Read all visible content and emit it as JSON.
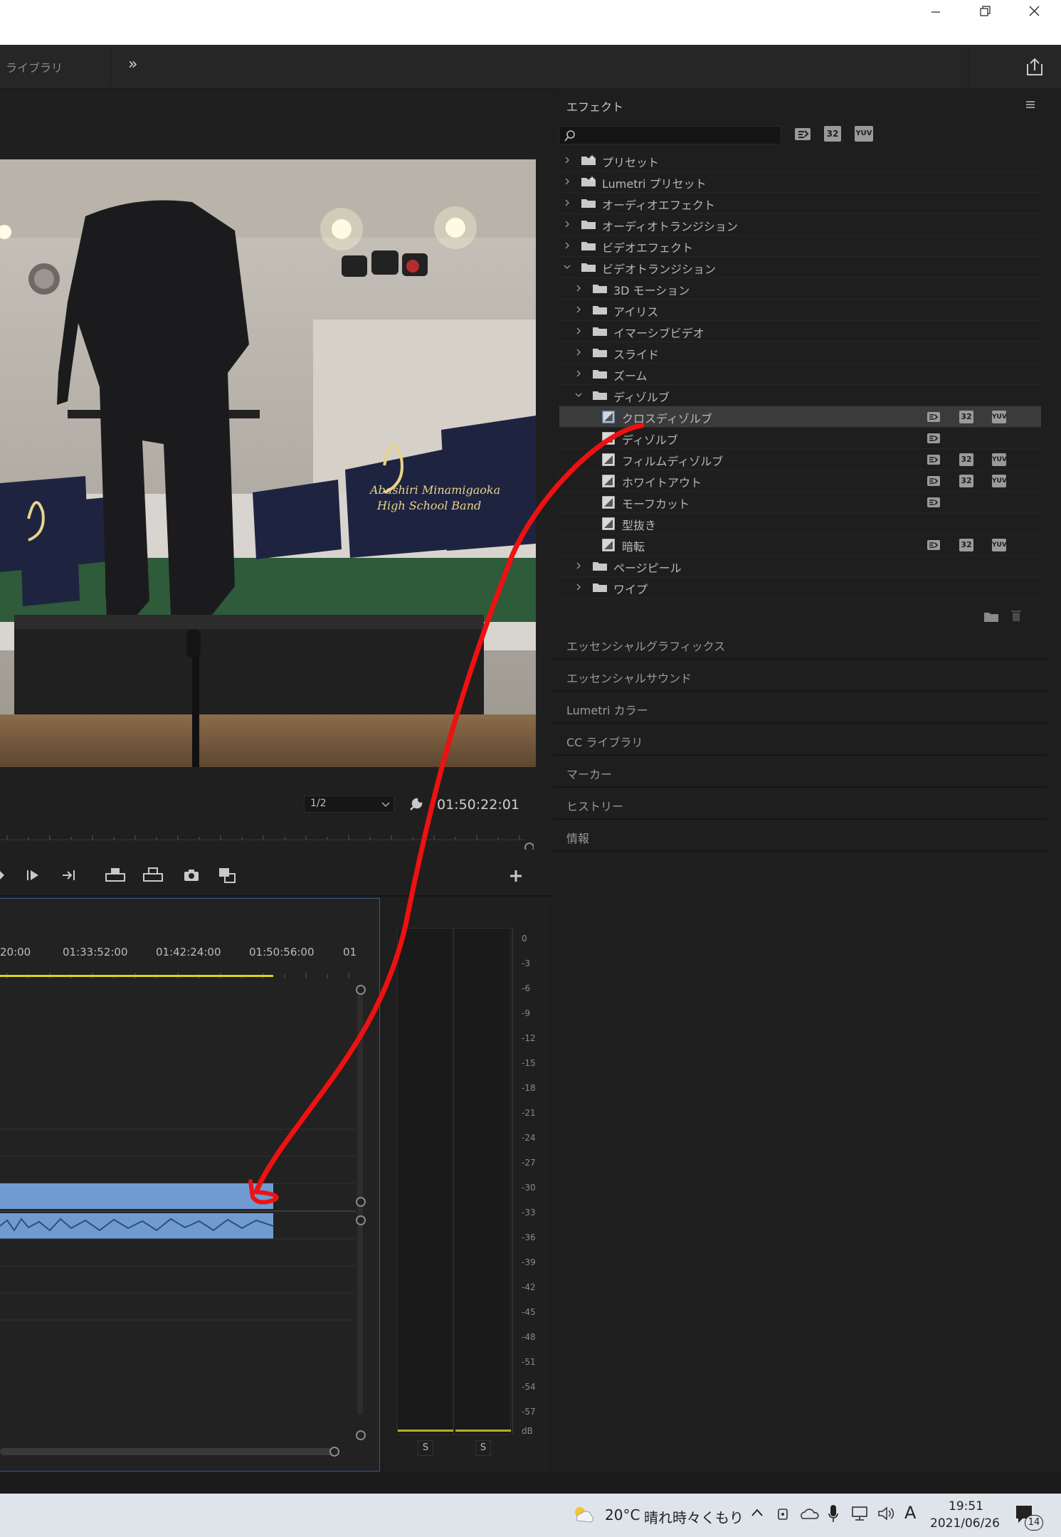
{
  "header": {
    "library_label": "ライブラリ",
    "more_label": "»"
  },
  "effects_panel": {
    "title": "エフェクト",
    "search": {
      "value": "",
      "placeholder": ""
    },
    "filter_badges": [
      "accelerated",
      "32",
      "YUV"
    ],
    "tree": [
      {
        "label": "プリセット",
        "level": 0,
        "expanded": false,
        "kind": "preset-folder"
      },
      {
        "label": "Lumetri プリセット",
        "level": 0,
        "expanded": false,
        "kind": "preset-folder"
      },
      {
        "label": "オーディオエフェクト",
        "level": 0,
        "expanded": false,
        "kind": "folder"
      },
      {
        "label": "オーディオトランジション",
        "level": 0,
        "expanded": false,
        "kind": "folder"
      },
      {
        "label": "ビデオエフェクト",
        "level": 0,
        "expanded": false,
        "kind": "folder"
      },
      {
        "label": "ビデオトランジション",
        "level": 0,
        "expanded": true,
        "kind": "folder"
      },
      {
        "label": "3D モーション",
        "level": 1,
        "expanded": false,
        "kind": "folder"
      },
      {
        "label": "アイリス",
        "level": 1,
        "expanded": false,
        "kind": "folder"
      },
      {
        "label": "イマーシブビデオ",
        "level": 1,
        "expanded": false,
        "kind": "folder"
      },
      {
        "label": "スライド",
        "level": 1,
        "expanded": false,
        "kind": "folder"
      },
      {
        "label": "ズーム",
        "level": 1,
        "expanded": false,
        "kind": "folder"
      },
      {
        "label": "ディゾルブ",
        "level": 1,
        "expanded": true,
        "kind": "folder"
      },
      {
        "label": "クロスディゾルブ",
        "level": 2,
        "kind": "effect",
        "selected": true,
        "badges": [
          "accelerated",
          "32",
          "YUV"
        ]
      },
      {
        "label": "ディゾルブ",
        "level": 2,
        "kind": "effect",
        "badges": [
          "accelerated"
        ]
      },
      {
        "label": "フィルムディゾルブ",
        "level": 2,
        "kind": "effect",
        "badges": [
          "accelerated",
          "32",
          "YUV"
        ]
      },
      {
        "label": "ホワイトアウト",
        "level": 2,
        "kind": "effect",
        "badges": [
          "accelerated",
          "32",
          "YUV"
        ]
      },
      {
        "label": "モーフカット",
        "level": 2,
        "kind": "effect",
        "badges": [
          "accelerated"
        ]
      },
      {
        "label": "型抜き",
        "level": 2,
        "kind": "effect",
        "badges": []
      },
      {
        "label": "暗転",
        "level": 2,
        "kind": "effect",
        "badges": [
          "accelerated",
          "32",
          "YUV"
        ]
      },
      {
        "label": "ページピール",
        "level": 1,
        "expanded": false,
        "kind": "folder"
      },
      {
        "label": "ワイプ",
        "level": 1,
        "expanded": false,
        "kind": "folder"
      }
    ]
  },
  "collapsed_panels": [
    "エッセンシャルグラフィックス",
    "エッセンシャルサウンド",
    "Lumetri カラー",
    "CC ライブラリ",
    "マーカー",
    "ヒストリー",
    "情報"
  ],
  "program_monitor": {
    "resolution": "1/2",
    "timecode": "01:50:22:01",
    "video_signs": [
      "Abashiri Minamigaoka",
      "High School Band"
    ]
  },
  "timeline": {
    "ruler_labels": [
      "20:00",
      "01:33:52:00",
      "01:42:24:00",
      "01:50:56:00",
      "01"
    ]
  },
  "audio_meter": {
    "scale": [
      "0",
      "-3",
      "-6",
      "-9",
      "-12",
      "-15",
      "-18",
      "-21",
      "-24",
      "-27",
      "-30",
      "-33",
      "-36",
      "-39",
      "-42",
      "-45",
      "-48",
      "-51",
      "-54",
      "-57",
      "dB"
    ],
    "solo_labels": [
      "S",
      "S"
    ]
  },
  "taskbar": {
    "weather_temp": "20°C",
    "weather_text": "晴れ時々くもり",
    "ime": "A",
    "time": "19:51",
    "date": "2021/06/26",
    "notifications": "14"
  },
  "colors": {
    "accent_blue": "#6f9bd1",
    "playhead_yellow": "#d8d21c",
    "annotation_red": "#ee1111",
    "panel_bg": "#1e1e1e"
  }
}
